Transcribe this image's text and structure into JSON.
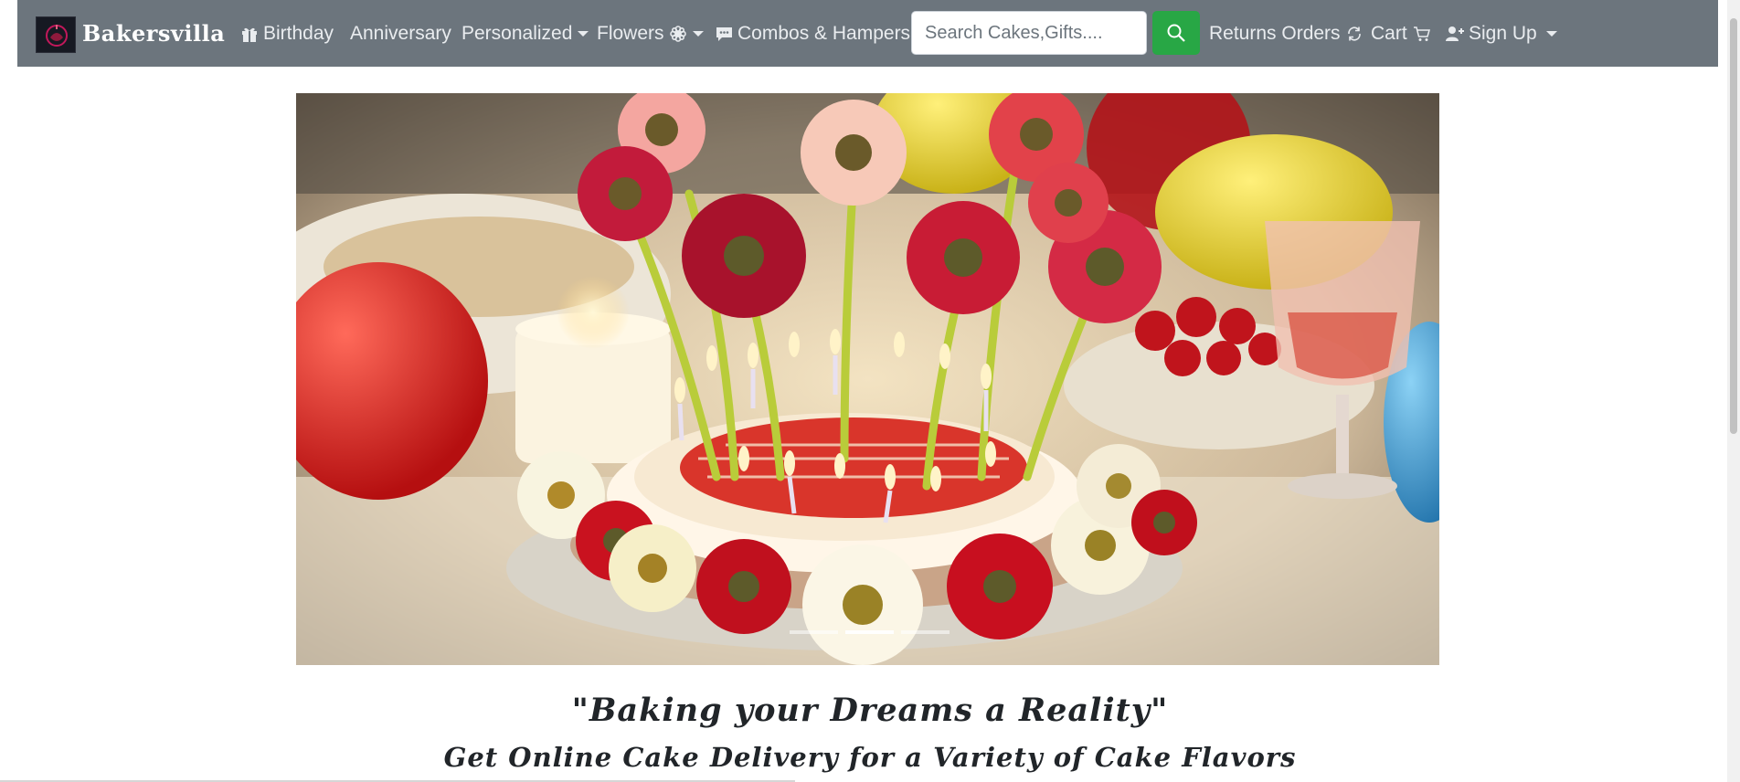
{
  "brand": {
    "name": "Bakersvilla",
    "logo_icon": "cake-logo-icon"
  },
  "nav": {
    "birthday": {
      "label": "Birthday",
      "icon": "gift-icon"
    },
    "anniversary": {
      "label": "Anniversary"
    },
    "personalized": {
      "label": "Personalized",
      "icon": "caret-down-icon"
    },
    "flowers": {
      "label": "Flowers",
      "icon": "flower-icon"
    },
    "combos": {
      "label": "Combos & Hampers",
      "icon": "chat-bubble-icon"
    },
    "returns": {
      "label": "Returns Orders",
      "icon": "refresh-icon"
    },
    "cart": {
      "label": "Cart",
      "icon": "cart-icon"
    },
    "signup": {
      "label": "Sign Up",
      "icon": "user-plus-icon"
    }
  },
  "search": {
    "placeholder": "Search Cakes,Gifts....",
    "value": "",
    "button_icon": "search-icon"
  },
  "hero": {
    "image": "birthday-cake-with-flowers-and-candles",
    "slides": 3,
    "active_slide": 2
  },
  "tagline": {
    "main": "\"Baking your Dreams a Reality\"",
    "sub": "Get Online Cake Delivery for a Variety of Cake Flavors"
  },
  "colors": {
    "navbar": "#6c757d",
    "nav_text": "#e9ecef",
    "search_button": "#28a745",
    "heading_text": "#212529"
  }
}
